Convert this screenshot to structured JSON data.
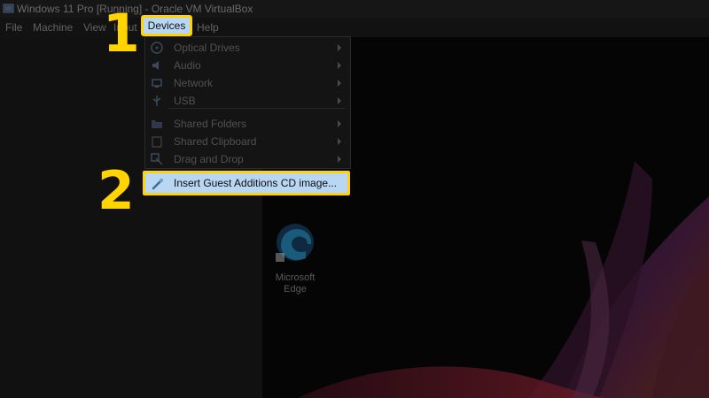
{
  "window": {
    "title": "Windows 11 Pro [Running] - Oracle VM VirtualBox"
  },
  "menubar": {
    "items": [
      "File",
      "Machine",
      "View",
      "Input",
      "Devices",
      "Help"
    ]
  },
  "devices_menu": {
    "items": [
      {
        "label": "Optical Drives",
        "icon": "optical-drive-icon",
        "submenu": true
      },
      {
        "label": "Audio",
        "icon": "audio-icon",
        "submenu": true
      },
      {
        "label": "Network",
        "icon": "network-icon",
        "submenu": true
      },
      {
        "label": "USB",
        "icon": "usb-icon",
        "submenu": true
      },
      {
        "label": "Shared Folders",
        "icon": "shared-folder-icon",
        "submenu": true
      },
      {
        "label": "Shared Clipboard",
        "icon": "clipboard-icon",
        "submenu": true
      },
      {
        "label": "Drag and Drop",
        "icon": "drag-drop-icon",
        "submenu": true
      },
      {
        "label": "Insert Guest Additions CD image...",
        "icon": "cd-insert-icon",
        "submenu": false
      }
    ]
  },
  "annotations": {
    "step1": "1",
    "step2": "2",
    "highlight_color": "#ffd400"
  },
  "desktop": {
    "icon_label_line1": "Microsoft",
    "icon_label_line2": "Edge"
  },
  "colors": {
    "selection": "#b9d7f2",
    "background": "#0b0b0b"
  }
}
